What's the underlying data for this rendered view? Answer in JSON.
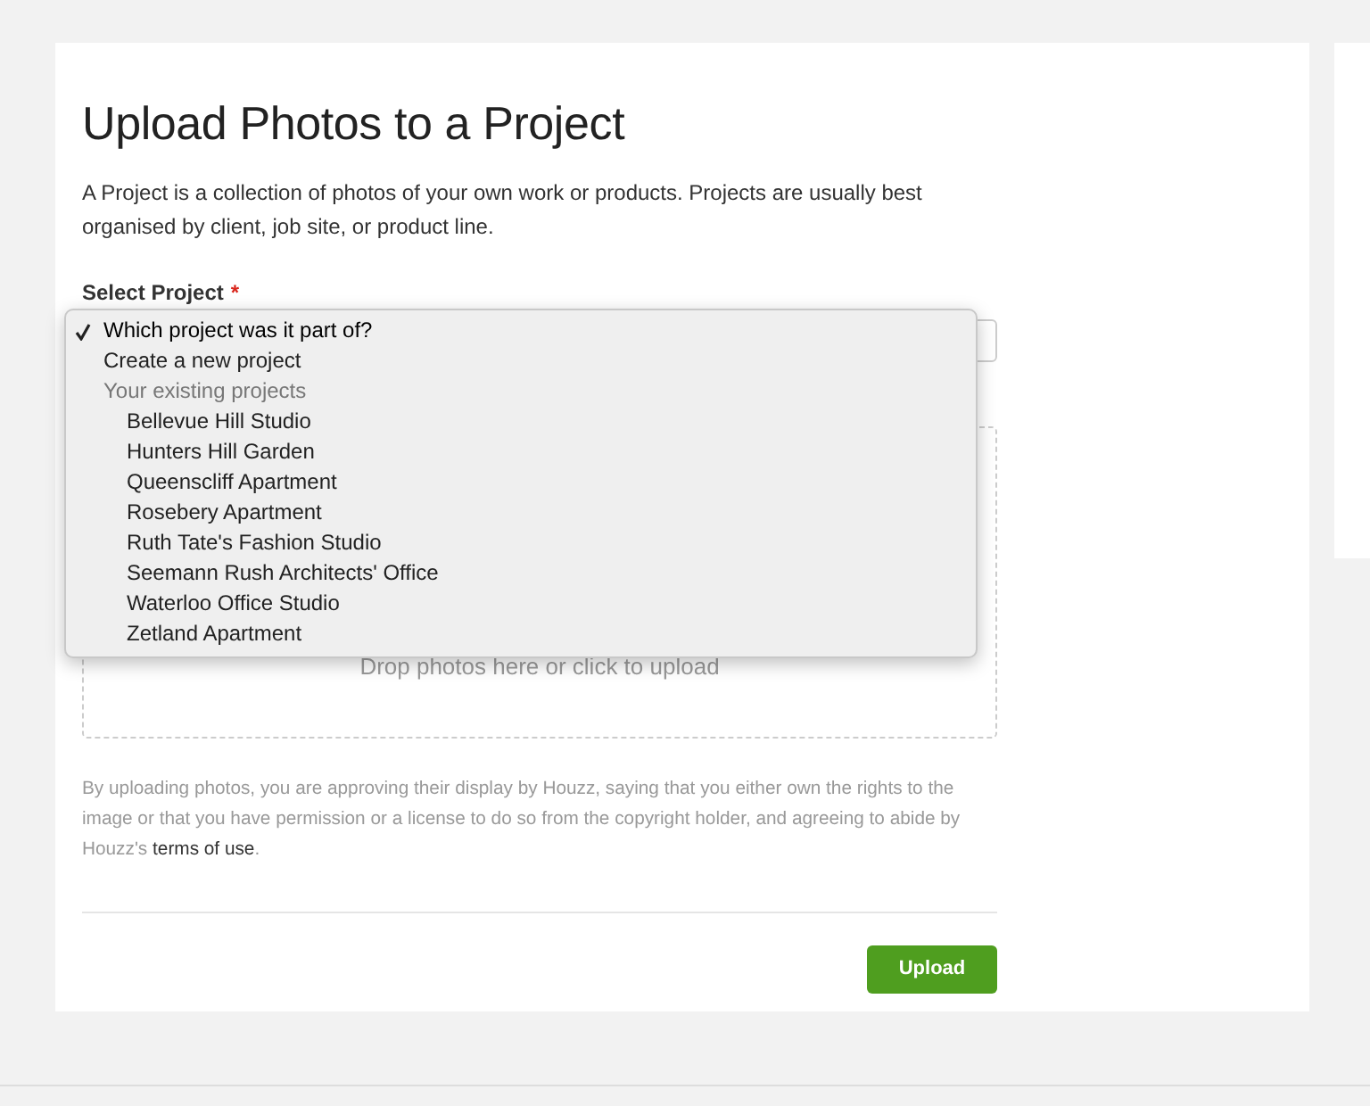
{
  "title": "Upload Photos to a Project",
  "intro": "A Project is a collection of photos of your own work or products. Projects are usually best organised by client, job site, or product line.",
  "select_label": "Select Project",
  "required_mark": "*",
  "dropdown": [
    {
      "kind": "option",
      "label": "Which project was it part of?",
      "selected": true
    },
    {
      "kind": "option",
      "label": "Create a new project",
      "selected": false
    },
    {
      "kind": "group",
      "label": "Your existing projects",
      "children": [
        {
          "label": "Bellevue Hill Studio",
          "selected": false
        },
        {
          "label": "Hunters Hill Garden",
          "selected": false
        },
        {
          "label": "Queenscliff Apartment",
          "selected": false
        },
        {
          "label": "Rosebery Apartment",
          "selected": false
        },
        {
          "label": "Ruth Tate's Fashion Studio",
          "selected": false
        },
        {
          "label": "Seemann Rush Architects' Office",
          "selected": false
        },
        {
          "label": "Waterloo Office Studio",
          "selected": false
        },
        {
          "label": "Zetland Apartment",
          "selected": false
        }
      ]
    }
  ],
  "drop_zone": {
    "text": "Drop photos here or click to upload"
  },
  "disclaimer": {
    "text": "By uploading photos, you are approving their display by Houzz, saying that you either own the rights to the image or that you have permission or a license to do so from the copyright holder, and agreeing to abide by Houzz's",
    "link": "terms of use",
    "end": "."
  },
  "upload_button": "Upload"
}
